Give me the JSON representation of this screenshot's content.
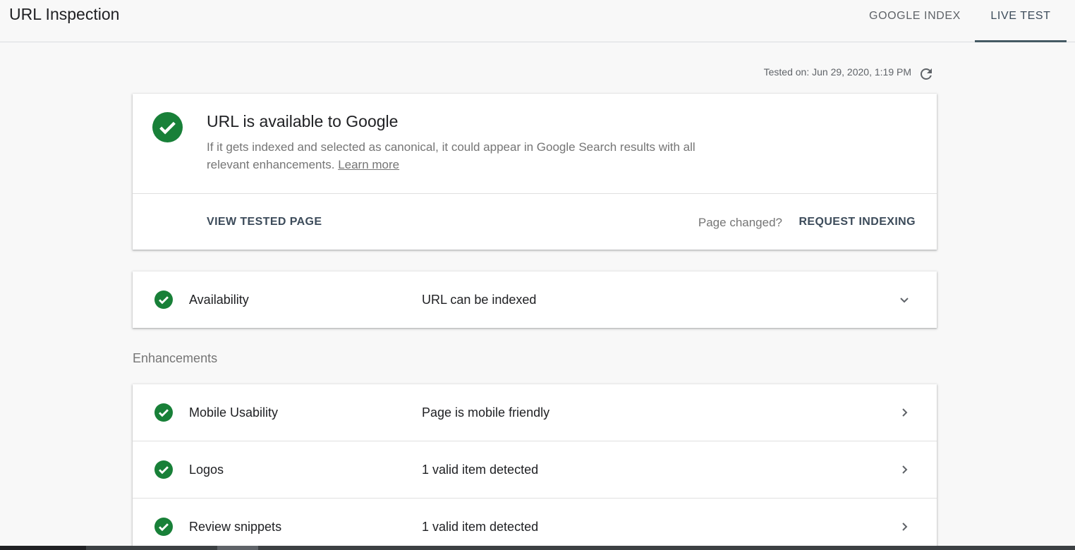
{
  "header": {
    "title": "URL Inspection",
    "tabs": [
      {
        "label": "GOOGLE INDEX",
        "active": false
      },
      {
        "label": "LIVE TEST",
        "active": true
      }
    ]
  },
  "tested_on": "Tested on: Jun 29, 2020, 1:19 PM",
  "status_card": {
    "title": "URL is available to Google",
    "description": "If it gets indexed and selected as canonical, it could appear in Google Search results with all relevant enhancements.",
    "learn_more": "Learn more",
    "view_tested_page": "VIEW TESTED PAGE",
    "page_changed": "Page changed?",
    "request_indexing": "REQUEST INDEXING"
  },
  "availability": {
    "label": "Availability",
    "value": "URL can be indexed"
  },
  "enhancements": {
    "heading": "Enhancements",
    "items": [
      {
        "label": "Mobile Usability",
        "value": "Page is mobile friendly"
      },
      {
        "label": "Logos",
        "value": "1 valid item detected"
      },
      {
        "label": "Review snippets",
        "value": "1 valid item detected"
      }
    ]
  },
  "colors": {
    "success": "#188038",
    "accent": "#455a64"
  },
  "icons": {
    "refresh": "refresh-icon",
    "status": "check-circle-icon",
    "expand": "chevron-down-icon",
    "navigate": "chevron-right-icon"
  }
}
